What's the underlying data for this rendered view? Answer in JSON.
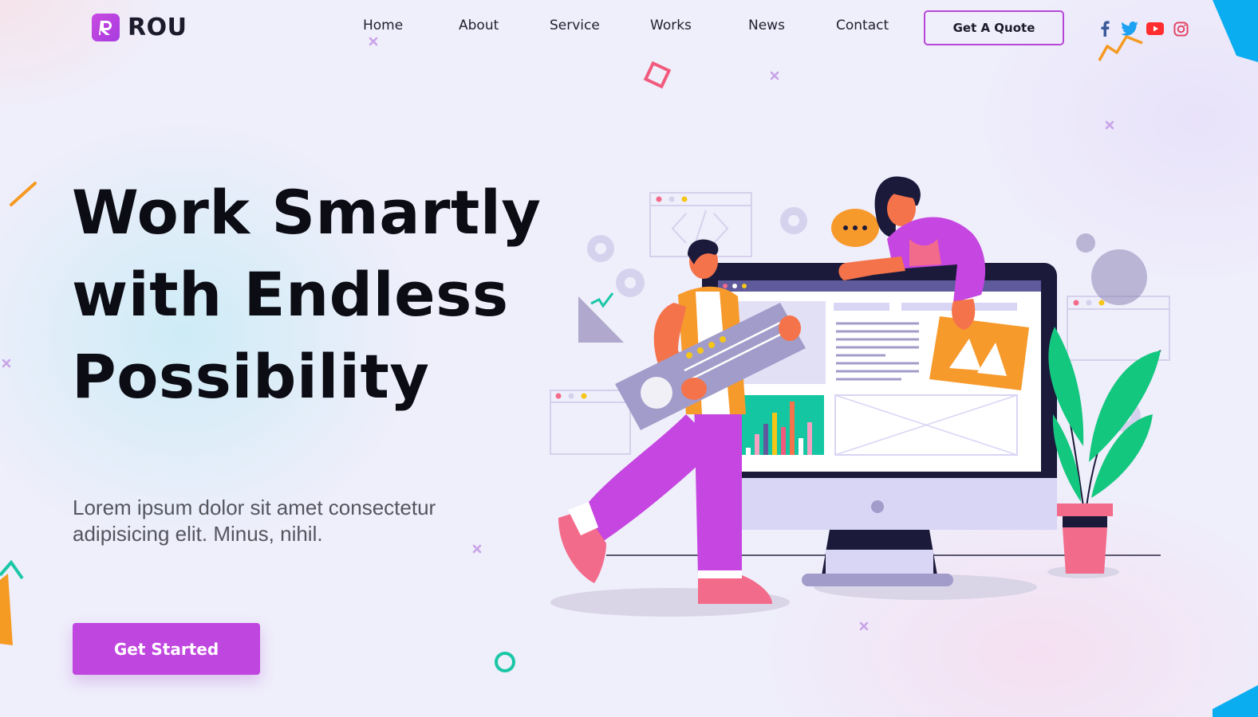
{
  "brand": {
    "name": "ROU",
    "logo_icon": "rou-logo-icon"
  },
  "nav": {
    "items": [
      {
        "label": "Home"
      },
      {
        "label": "About"
      },
      {
        "label": "Service"
      },
      {
        "label": "Works"
      },
      {
        "label": "News"
      },
      {
        "label": "Contact"
      }
    ],
    "quote_button": "Get A Quote"
  },
  "social": [
    {
      "icon": "facebook-icon",
      "color": "#3b5998"
    },
    {
      "icon": "twitter-icon",
      "color": "#1da1f2"
    },
    {
      "icon": "youtube-icon",
      "color": "#ff2d2d"
    },
    {
      "icon": "instagram-icon",
      "color": "#e4405f"
    }
  ],
  "hero": {
    "headline_lines": [
      "Work Smartly",
      "with Endless",
      "Possibility"
    ],
    "subtext_lines": [
      "Lorem ipsum dolor sit amet consectetur",
      "adipisicing elit. Minus, nihil."
    ],
    "cta_label": "Get Started"
  },
  "colors": {
    "accent": "#c046e0",
    "text_dark": "#0c0c14",
    "text_muted": "#55555f"
  }
}
